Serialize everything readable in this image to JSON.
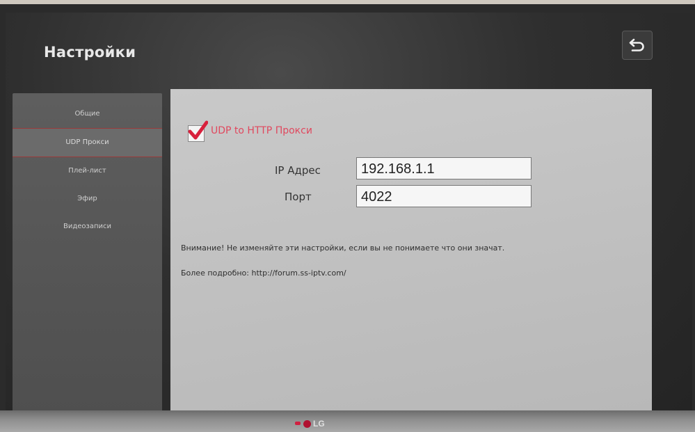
{
  "screen": {
    "title": "Настройки",
    "back_icon": "back-arrow-icon"
  },
  "sidebar": {
    "items": [
      {
        "label": "Общие",
        "active": false
      },
      {
        "label": "UDP Прокси",
        "active": true
      },
      {
        "label": "Плей-лист",
        "active": false
      },
      {
        "label": "Эфир",
        "active": false
      },
      {
        "label": "Видеозаписи",
        "active": false
      }
    ]
  },
  "proxy": {
    "checkbox_label": "UDP to HTTP Прокси",
    "checked": true,
    "ip_label": "IP Адрес",
    "ip_value": "192.168.1.1",
    "port_label": "Порт",
    "port_value": "4022"
  },
  "notes": {
    "warning": "Внимание! Не изменяйте эти настройки, если вы не понимаете что они значат.",
    "more_info": "Более подробно: http://forum.ss-iptv.com/"
  },
  "tv": {
    "brand": "LG"
  },
  "colors": {
    "accent": "#e0485e",
    "checkmark": "#d8203c",
    "panel_bg": "#c4c4c4",
    "sidebar_bg": "#585858",
    "screen_bg": "#2f2f2f"
  }
}
